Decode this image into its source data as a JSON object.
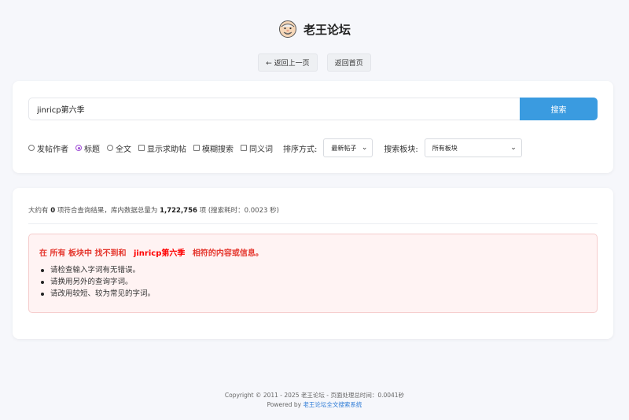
{
  "header": {
    "title": "老王论坛",
    "logo_icon": "old-man-face-icon"
  },
  "nav": {
    "back_label": "← 返回上一页",
    "home_label": "返回首页"
  },
  "search": {
    "query": "jinricp第六季",
    "button_label": "搜索"
  },
  "options": {
    "scope": [
      {
        "label": "发帖作者",
        "checked": false
      },
      {
        "label": "标题",
        "checked": true
      },
      {
        "label": "全文",
        "checked": false
      }
    ],
    "checkboxes": [
      {
        "label": "显示求助帖",
        "checked": false
      },
      {
        "label": "模糊搜索",
        "checked": false
      },
      {
        "label": "同义词",
        "checked": false
      }
    ],
    "sort_label": "排序方式:",
    "sort_value": "最新帖子",
    "forum_label": "搜索板块:",
    "forum_value": "所有板块"
  },
  "results": {
    "summary_pre": "大约有",
    "count": "0",
    "summary_mid": "项符合查询结果，库内数据总量为",
    "total": "1,722,756",
    "summary_post": "项 (搜索耗时：0.0023 秒)",
    "notice_pre": "在 所有 板块中 找不到和",
    "notice_keyword": "jinricp第六季",
    "notice_post": "相符的内容或信息。",
    "tips": [
      "请检查输入字词有无错误。",
      "请换用另外的查询字词。",
      "请改用较短、较为常见的字词。"
    ]
  },
  "footer": {
    "copyright": "Copyright © 2011 - 2025 老王论坛 - 页面处理总时间：0.0041秒",
    "powered_pre": "Powered by",
    "powered_link": "老王论坛全文搜索系统"
  },
  "colors": {
    "accent": "#3a9be0",
    "error": "#e5372e",
    "radio_checked": "#a04fd6",
    "link": "#2d7bd6"
  }
}
